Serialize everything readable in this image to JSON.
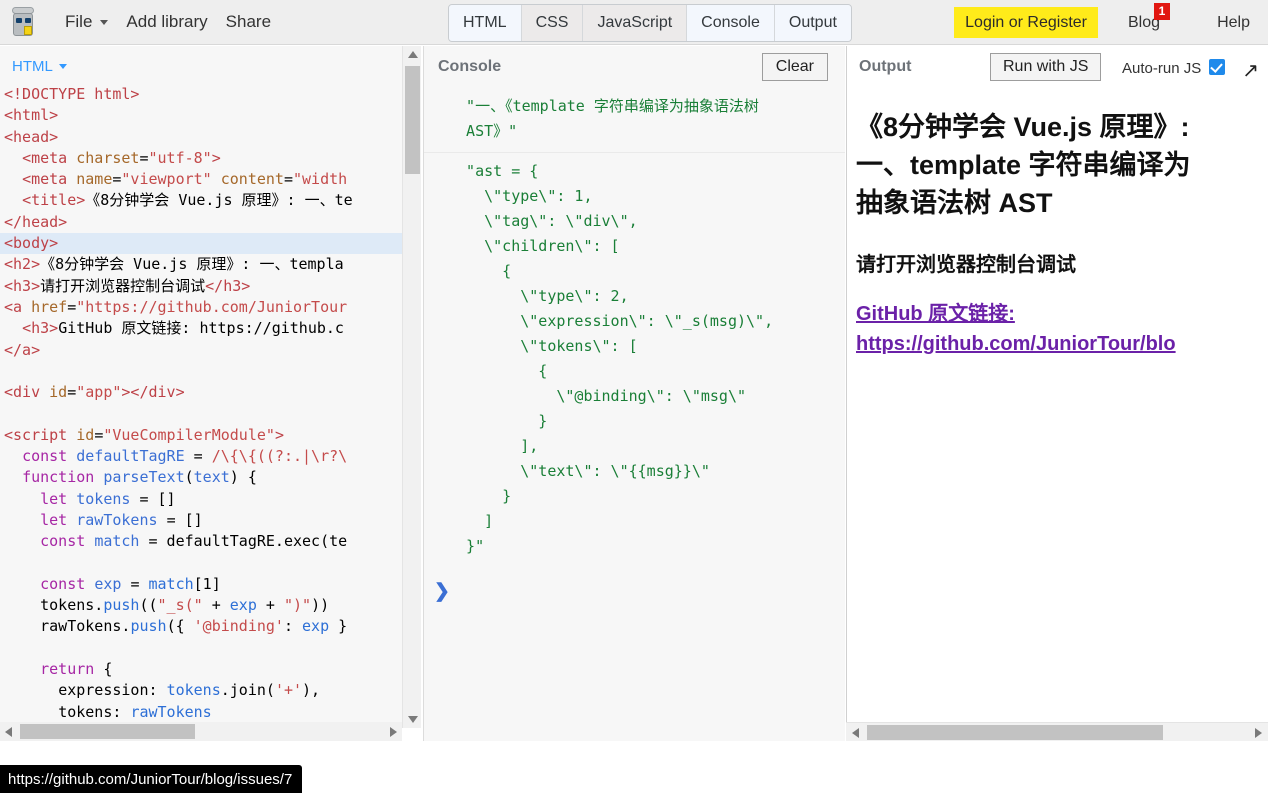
{
  "topbar": {
    "logo_name": "jsfiddle-robot-logo",
    "menu": [
      {
        "label": "File",
        "has_caret": true
      },
      {
        "label": "Add library",
        "has_caret": false
      },
      {
        "label": "Share",
        "has_caret": false
      }
    ],
    "tabs": [
      {
        "label": "HTML",
        "active": true
      },
      {
        "label": "CSS",
        "active": false
      },
      {
        "label": "JavaScript",
        "active": false
      },
      {
        "label": "Console",
        "active": true
      },
      {
        "label": "Output",
        "active": true
      }
    ],
    "login_label": "Login or Register",
    "login_bg": "#ffeb1a",
    "blog_label": "Blog",
    "blog_badge": "1",
    "blog_badge_color": "#e1160f",
    "help_label": "Help"
  },
  "editor": {
    "mode_label": "HTML",
    "lines": [
      {
        "html": "<span class=\"tg\">&lt;!DOCTYPE html&gt;</span>",
        "highlight": false
      },
      {
        "html": "<span class=\"tg\">&lt;html&gt;</span>",
        "highlight": false
      },
      {
        "html": "<span class=\"tg\">&lt;head&gt;</span>",
        "highlight": false
      },
      {
        "html": "  <span class=\"tg\">&lt;meta </span><span class=\"at\">charset</span><span class=\"pl\">=</span><span class=\"st\">\"utf-8\"</span><span class=\"tg\">&gt;</span>",
        "highlight": false
      },
      {
        "html": "  <span class=\"tg\">&lt;meta </span><span class=\"at\">name</span><span class=\"pl\">=</span><span class=\"st\">\"viewport\"</span> <span class=\"at\">content</span><span class=\"pl\">=</span><span class=\"st\">\"width</span>",
        "highlight": false
      },
      {
        "html": "  <span class=\"tg\">&lt;title&gt;</span><span class=\"pl\">《8分钟学会 Vue.js 原理》: 一、te</span>",
        "highlight": false
      },
      {
        "html": "<span class=\"tg\">&lt;/head&gt;</span>",
        "highlight": false
      },
      {
        "html": "<span class=\"tg\">&lt;body&gt;</span>",
        "highlight": true
      },
      {
        "html": "<span class=\"tg\">&lt;h2&gt;</span><span class=\"pl\">《8分钟学会 Vue.js 原理》: 一、templa</span>",
        "highlight": false
      },
      {
        "html": "<span class=\"tg\">&lt;h3&gt;</span><span class=\"pl\">请打开浏览器控制台调试</span><span class=\"tg\">&lt;/h3&gt;</span>",
        "highlight": false
      },
      {
        "html": "<span class=\"tg\">&lt;a </span><span class=\"at\">href</span><span class=\"pl\">=</span><span class=\"st\">\"https://github.com/JuniorTour</span>",
        "highlight": false
      },
      {
        "html": "  <span class=\"tg\">&lt;h3&gt;</span><span class=\"pl\">GitHub 原文链接: https://github.c</span>",
        "highlight": false
      },
      {
        "html": "<span class=\"tg\">&lt;/a&gt;</span>",
        "highlight": false
      },
      {
        "html": "",
        "highlight": false
      },
      {
        "html": "<span class=\"tg\">&lt;div </span><span class=\"at\">id</span><span class=\"pl\">=</span><span class=\"st\">\"app\"</span><span class=\"tg\">&gt;&lt;/div&gt;</span>",
        "highlight": false
      },
      {
        "html": "",
        "highlight": false
      },
      {
        "html": "<span class=\"tg\">&lt;script </span><span class=\"at\">id</span><span class=\"pl\">=</span><span class=\"st\">\"VueCompilerModule\"</span><span class=\"tg\">&gt;</span>",
        "highlight": false
      },
      {
        "html": "  <span class=\"kw\">const</span> <span class=\"fn\">defaultTagRE</span> <span class=\"pl\">=</span> <span class=\"st\">/\\{\\{((?:.|\\r?\\</span>",
        "highlight": false
      },
      {
        "html": "  <span class=\"kw\">function</span> <span class=\"fn\">parseText</span><span class=\"pl\">(</span><span class=\"fn\">text</span><span class=\"pl\">) {</span>",
        "highlight": false
      },
      {
        "html": "    <span class=\"kw\">let</span> <span class=\"fn\">tokens</span> <span class=\"pl\">= []</span>",
        "highlight": false
      },
      {
        "html": "    <span class=\"kw\">let</span> <span class=\"fn\">rawTokens</span> <span class=\"pl\">= []</span>",
        "highlight": false
      },
      {
        "html": "    <span class=\"kw\">const</span> <span class=\"fn\">match</span> <span class=\"pl\">= defaultTagRE.exec(te</span>",
        "highlight": false
      },
      {
        "html": "",
        "highlight": false
      },
      {
        "html": "    <span class=\"kw\">const</span> <span class=\"fn\">exp</span> <span class=\"pl\">= </span><span class=\"nm\">match</span><span class=\"pl\">[1]</span>",
        "highlight": false
      },
      {
        "html": "    <span class=\"pl\">tokens.</span><span class=\"nm\">push</span><span class=\"pl\">((</span><span class=\"st\">\"_s(\"</span><span class=\"pl\"> + </span><span class=\"nm\">exp</span><span class=\"pl\"> + </span><span class=\"st\">\")\"</span><span class=\"pl\">))</span>",
        "highlight": false
      },
      {
        "html": "    <span class=\"pl\">rawTokens.</span><span class=\"nm\">push</span><span class=\"pl\">({ </span><span class=\"st\">'@binding'</span><span class=\"pl\">: </span><span class=\"nm\">exp</span><span class=\"pl\"> }</span>",
        "highlight": false
      },
      {
        "html": "",
        "highlight": false
      },
      {
        "html": "    <span class=\"kw\">return</span> <span class=\"pl\">{</span>",
        "highlight": false
      },
      {
        "html": "      <span class=\"pl\">expression: </span><span class=\"nm\">tokens</span><span class=\"pl\">.join(</span><span class=\"st\">'+'</span><span class=\"pl\">),</span>",
        "highlight": false
      },
      {
        "html": "      <span class=\"pl\">tokens: </span><span class=\"nm\">rawTokens</span>",
        "highlight": false
      }
    ]
  },
  "console": {
    "title": "Console",
    "clear_label": "Clear",
    "prompt_glyph": "❯",
    "entries": [
      "  \"一、《template 字符串编译为抽象语法树\n  AST》\"",
      "  \"ast = {\n    \\\"type\\\": 1,\n    \\\"tag\\\": \\\"div\\\",\n    \\\"children\\\": [\n      {\n        \\\"type\\\": 2,\n        \\\"expression\\\": \\\"_s(msg)\\\",\n        \\\"tokens\\\": [\n          {\n            \\\"@binding\\\": \\\"msg\\\"\n          }\n        ],\n        \\\"text\\\": \\\"{{msg}}\\\"\n      }\n    ]\n  }\""
    ],
    "text_color": "#1a7f37"
  },
  "output": {
    "title": "Output",
    "run_label": "Run with JS",
    "autorun_label": "Auto-run JS",
    "autorun_checked": true,
    "autorun_color": "#1f8aeb",
    "popout_glyph": "↗",
    "heading_lines": [
      "《8分钟学会 Vue.js 原理》:",
      "一、template 字符串编译为",
      "抽象语法树 AST"
    ],
    "subheading": "请打开浏览器控制台调试",
    "link_lines": [
      "GitHub 原文链接: ",
      "https://github.com/JuniorTour/blo"
    ],
    "link_color": "#6b21a8"
  },
  "status": {
    "url": "https://github.com/JuniorTour/blog/issues/7"
  }
}
